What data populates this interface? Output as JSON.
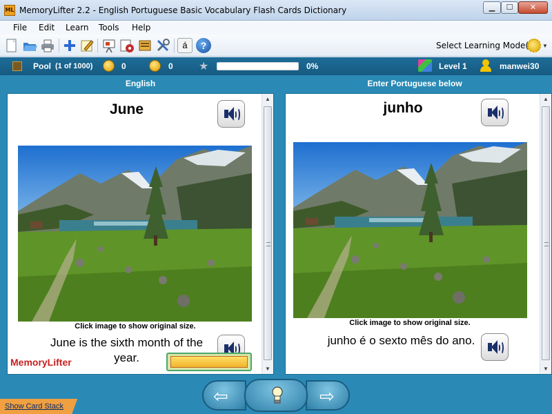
{
  "window": {
    "title": "MemoryLifter 2.2 - English Portuguese Basic Vocabulary Flash Cards Dictionary",
    "app_icon_text": "ML",
    "minimize": "▁",
    "maximize": "☐",
    "close": "✕"
  },
  "menu": [
    "File",
    "Edit",
    "Learn",
    "Tools",
    "Help"
  ],
  "toolbar": {
    "icons": [
      "new-icon",
      "open-icon",
      "print-icon",
      "add-icon",
      "edit-icon",
      "presentation-icon",
      "media-icon",
      "card-icon",
      "settings-icon",
      "character-icon",
      "help-icon"
    ],
    "character_label": "á",
    "help_label": "?",
    "mode_label": "Select Learning Mode(s)"
  },
  "status": {
    "pool_label": "Pool",
    "pool_count": "(1 of 1000)",
    "correct_count": "0",
    "wrong_count": "0",
    "progress_percent": "0%",
    "progress_value": 0,
    "level": "Level 1",
    "user": "manwei30"
  },
  "columns": {
    "left_header": "English",
    "right_header": "Enter Portuguese below"
  },
  "card_left": {
    "word": "June",
    "caption": "Click image to show original size.",
    "sentence": "June is the sixth month of the year.",
    "watermark": "MemoryLifter"
  },
  "card_right": {
    "word": "junho",
    "caption": "Click image to show original size.",
    "sentence": "junho é o sexto mês do ano."
  },
  "nav": {
    "prev_glyph": "⇦",
    "next_glyph": "⇨"
  },
  "footer": {
    "show_stack": "Show Card Stack"
  },
  "colors": {
    "main_bg": "#2a8ab5",
    "status_bg": "#165a81",
    "progress_fill": "#3aa5d8",
    "accent_orange": "#f0a040"
  }
}
